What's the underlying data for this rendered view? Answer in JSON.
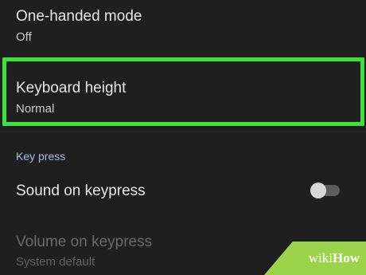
{
  "settings": {
    "one_handed": {
      "title": "One-handed mode",
      "summary": "Off"
    },
    "keyboard_height": {
      "title": "Keyboard height",
      "summary": "Normal"
    },
    "section_key_press": "Key press",
    "sound_on_keypress": {
      "title": "Sound on keypress",
      "enabled": false
    },
    "volume_on_keypress": {
      "title": "Volume on keypress",
      "summary": "System default",
      "disabled": true
    }
  },
  "highlight_color": "#3be33b",
  "watermark": {
    "wiki": "wiki",
    "how": "How"
  }
}
